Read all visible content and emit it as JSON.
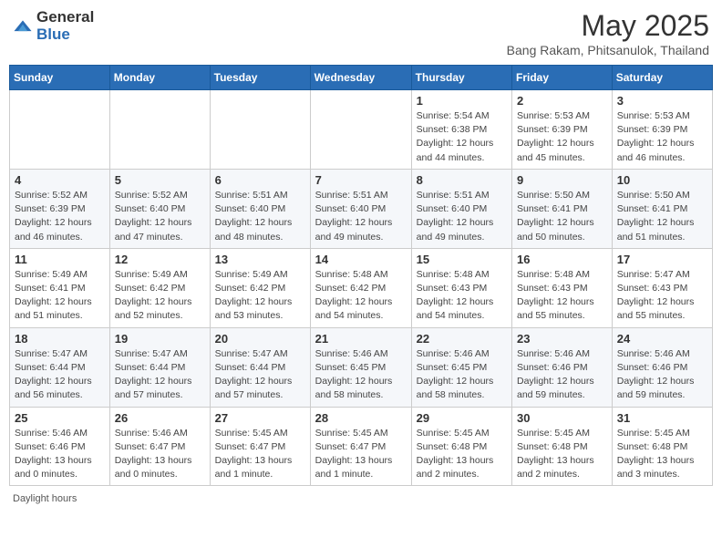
{
  "logo": {
    "text_general": "General",
    "text_blue": "Blue"
  },
  "title": "May 2025",
  "subtitle": "Bang Rakam, Phitsanulok, Thailand",
  "days_header": [
    "Sunday",
    "Monday",
    "Tuesday",
    "Wednesday",
    "Thursday",
    "Friday",
    "Saturday"
  ],
  "footer": "Daylight hours",
  "weeks": [
    [
      {
        "day": "",
        "info": ""
      },
      {
        "day": "",
        "info": ""
      },
      {
        "day": "",
        "info": ""
      },
      {
        "day": "",
        "info": ""
      },
      {
        "day": "1",
        "info": "Sunrise: 5:54 AM\nSunset: 6:38 PM\nDaylight: 12 hours\nand 44 minutes."
      },
      {
        "day": "2",
        "info": "Sunrise: 5:53 AM\nSunset: 6:39 PM\nDaylight: 12 hours\nand 45 minutes."
      },
      {
        "day": "3",
        "info": "Sunrise: 5:53 AM\nSunset: 6:39 PM\nDaylight: 12 hours\nand 46 minutes."
      }
    ],
    [
      {
        "day": "4",
        "info": "Sunrise: 5:52 AM\nSunset: 6:39 PM\nDaylight: 12 hours\nand 46 minutes."
      },
      {
        "day": "5",
        "info": "Sunrise: 5:52 AM\nSunset: 6:40 PM\nDaylight: 12 hours\nand 47 minutes."
      },
      {
        "day": "6",
        "info": "Sunrise: 5:51 AM\nSunset: 6:40 PM\nDaylight: 12 hours\nand 48 minutes."
      },
      {
        "day": "7",
        "info": "Sunrise: 5:51 AM\nSunset: 6:40 PM\nDaylight: 12 hours\nand 49 minutes."
      },
      {
        "day": "8",
        "info": "Sunrise: 5:51 AM\nSunset: 6:40 PM\nDaylight: 12 hours\nand 49 minutes."
      },
      {
        "day": "9",
        "info": "Sunrise: 5:50 AM\nSunset: 6:41 PM\nDaylight: 12 hours\nand 50 minutes."
      },
      {
        "day": "10",
        "info": "Sunrise: 5:50 AM\nSunset: 6:41 PM\nDaylight: 12 hours\nand 51 minutes."
      }
    ],
    [
      {
        "day": "11",
        "info": "Sunrise: 5:49 AM\nSunset: 6:41 PM\nDaylight: 12 hours\nand 51 minutes."
      },
      {
        "day": "12",
        "info": "Sunrise: 5:49 AM\nSunset: 6:42 PM\nDaylight: 12 hours\nand 52 minutes."
      },
      {
        "day": "13",
        "info": "Sunrise: 5:49 AM\nSunset: 6:42 PM\nDaylight: 12 hours\nand 53 minutes."
      },
      {
        "day": "14",
        "info": "Sunrise: 5:48 AM\nSunset: 6:42 PM\nDaylight: 12 hours\nand 54 minutes."
      },
      {
        "day": "15",
        "info": "Sunrise: 5:48 AM\nSunset: 6:43 PM\nDaylight: 12 hours\nand 54 minutes."
      },
      {
        "day": "16",
        "info": "Sunrise: 5:48 AM\nSunset: 6:43 PM\nDaylight: 12 hours\nand 55 minutes."
      },
      {
        "day": "17",
        "info": "Sunrise: 5:47 AM\nSunset: 6:43 PM\nDaylight: 12 hours\nand 55 minutes."
      }
    ],
    [
      {
        "day": "18",
        "info": "Sunrise: 5:47 AM\nSunset: 6:44 PM\nDaylight: 12 hours\nand 56 minutes."
      },
      {
        "day": "19",
        "info": "Sunrise: 5:47 AM\nSunset: 6:44 PM\nDaylight: 12 hours\nand 57 minutes."
      },
      {
        "day": "20",
        "info": "Sunrise: 5:47 AM\nSunset: 6:44 PM\nDaylight: 12 hours\nand 57 minutes."
      },
      {
        "day": "21",
        "info": "Sunrise: 5:46 AM\nSunset: 6:45 PM\nDaylight: 12 hours\nand 58 minutes."
      },
      {
        "day": "22",
        "info": "Sunrise: 5:46 AM\nSunset: 6:45 PM\nDaylight: 12 hours\nand 58 minutes."
      },
      {
        "day": "23",
        "info": "Sunrise: 5:46 AM\nSunset: 6:46 PM\nDaylight: 12 hours\nand 59 minutes."
      },
      {
        "day": "24",
        "info": "Sunrise: 5:46 AM\nSunset: 6:46 PM\nDaylight: 12 hours\nand 59 minutes."
      }
    ],
    [
      {
        "day": "25",
        "info": "Sunrise: 5:46 AM\nSunset: 6:46 PM\nDaylight: 13 hours\nand 0 minutes."
      },
      {
        "day": "26",
        "info": "Sunrise: 5:46 AM\nSunset: 6:47 PM\nDaylight: 13 hours\nand 0 minutes."
      },
      {
        "day": "27",
        "info": "Sunrise: 5:45 AM\nSunset: 6:47 PM\nDaylight: 13 hours\nand 1 minute."
      },
      {
        "day": "28",
        "info": "Sunrise: 5:45 AM\nSunset: 6:47 PM\nDaylight: 13 hours\nand 1 minute."
      },
      {
        "day": "29",
        "info": "Sunrise: 5:45 AM\nSunset: 6:48 PM\nDaylight: 13 hours\nand 2 minutes."
      },
      {
        "day": "30",
        "info": "Sunrise: 5:45 AM\nSunset: 6:48 PM\nDaylight: 13 hours\nand 2 minutes."
      },
      {
        "day": "31",
        "info": "Sunrise: 5:45 AM\nSunset: 6:48 PM\nDaylight: 13 hours\nand 3 minutes."
      }
    ]
  ]
}
